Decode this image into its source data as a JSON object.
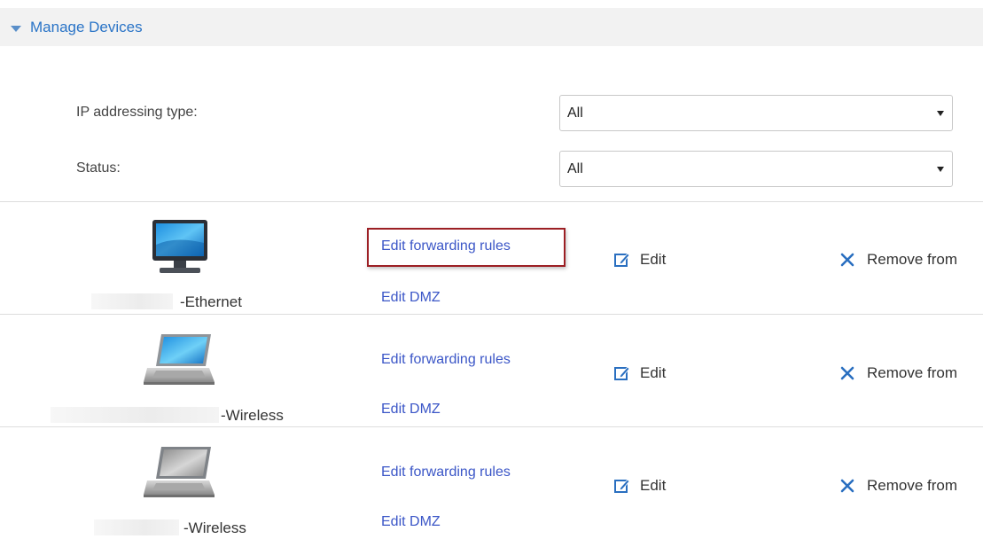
{
  "section": {
    "title": "Manage Devices"
  },
  "filters": {
    "ip_type": {
      "label": "IP addressing type:",
      "value": "All"
    },
    "status": {
      "label": "Status:",
      "value": "All"
    }
  },
  "colors": {
    "link": "#3b56c7",
    "header_title": "#2a74c7",
    "highlight": "#9c1f24",
    "action_icon": "#2a6fc0"
  },
  "devices": [
    {
      "icon": "desktop-monitor-icon",
      "name_suffix": "-Ethernet",
      "forwarding_link": "Edit forwarding rules",
      "dmz_link": "Edit DMZ",
      "edit_label": "Edit",
      "remove_label": "Remove from"
    },
    {
      "icon": "laptop-icon",
      "name_suffix": "-Wireless",
      "forwarding_link": "Edit forwarding rules",
      "dmz_link": "Edit DMZ",
      "edit_label": "Edit",
      "remove_label": "Remove from"
    },
    {
      "icon": "laptop-offline-icon",
      "name_suffix": "-Wireless",
      "forwarding_link": "Edit forwarding rules",
      "dmz_link": "Edit DMZ",
      "edit_label": "Edit",
      "remove_label": "Remove from"
    }
  ]
}
